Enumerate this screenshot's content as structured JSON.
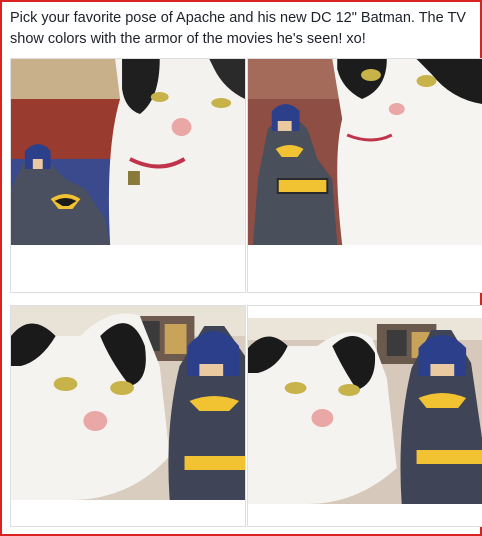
{
  "post": {
    "caption": "Pick your favorite pose of Apache and his new DC 12\" Batman. The TV show colors with the armor of the movies he's seen! xo!"
  },
  "photos": [
    {
      "icon": "cat-with-batman-photo"
    },
    {
      "icon": "cat-with-batman-photo"
    },
    {
      "icon": "cat-with-batman-photo"
    },
    {
      "icon": "cat-with-batman-photo"
    }
  ],
  "colors": {
    "frame_border": "#d9231e",
    "text": "#1d2129",
    "card_border": "#dcdee3"
  }
}
